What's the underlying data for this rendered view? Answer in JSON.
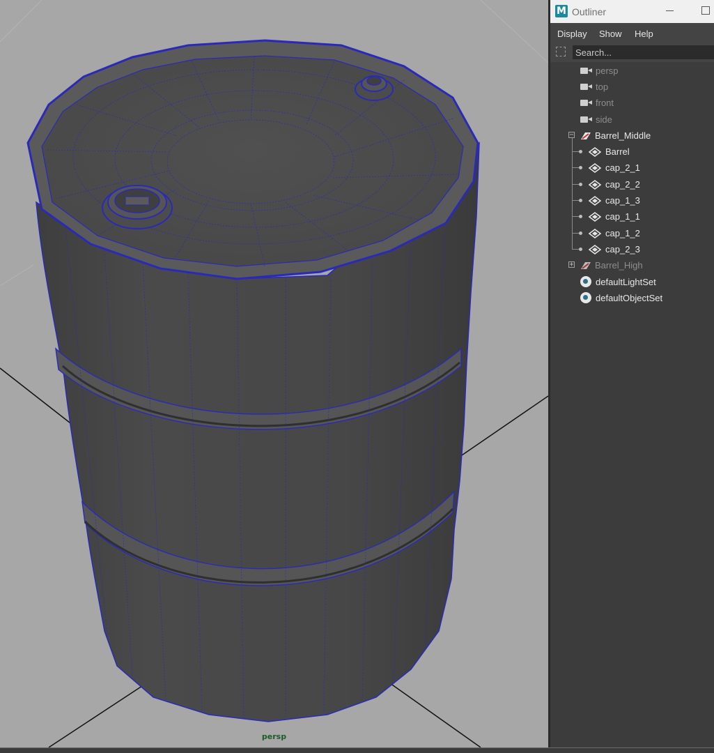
{
  "viewport": {
    "camera_label": "persp"
  },
  "outliner": {
    "title": "Outliner",
    "app_icon_letter": "M",
    "menu": [
      "Display",
      "Show",
      "Help"
    ],
    "search": {
      "placeholder": "Search...",
      "value": ""
    },
    "cameras": [
      {
        "label": "persp"
      },
      {
        "label": "top"
      },
      {
        "label": "front"
      },
      {
        "label": "side"
      }
    ],
    "groups": [
      {
        "label": "Barrel_Middle",
        "expanded": true,
        "children": [
          "Barrel",
          "cap_2_1",
          "cap_2_2",
          "cap_1_3",
          "cap_1_1",
          "cap_1_2",
          "cap_2_3"
        ]
      },
      {
        "label": "Barrel_High",
        "expanded": false,
        "children": []
      }
    ],
    "sets": [
      {
        "label": "defaultLightSet"
      },
      {
        "label": "defaultObjectSet"
      }
    ]
  },
  "colors": {
    "viewport_bg": "#a7a7a7",
    "mesh_fill": "#474747",
    "wire": "#2a2ab8",
    "camera_label": "#1f5a2a",
    "outliner_bg": "#3c3c3c"
  }
}
